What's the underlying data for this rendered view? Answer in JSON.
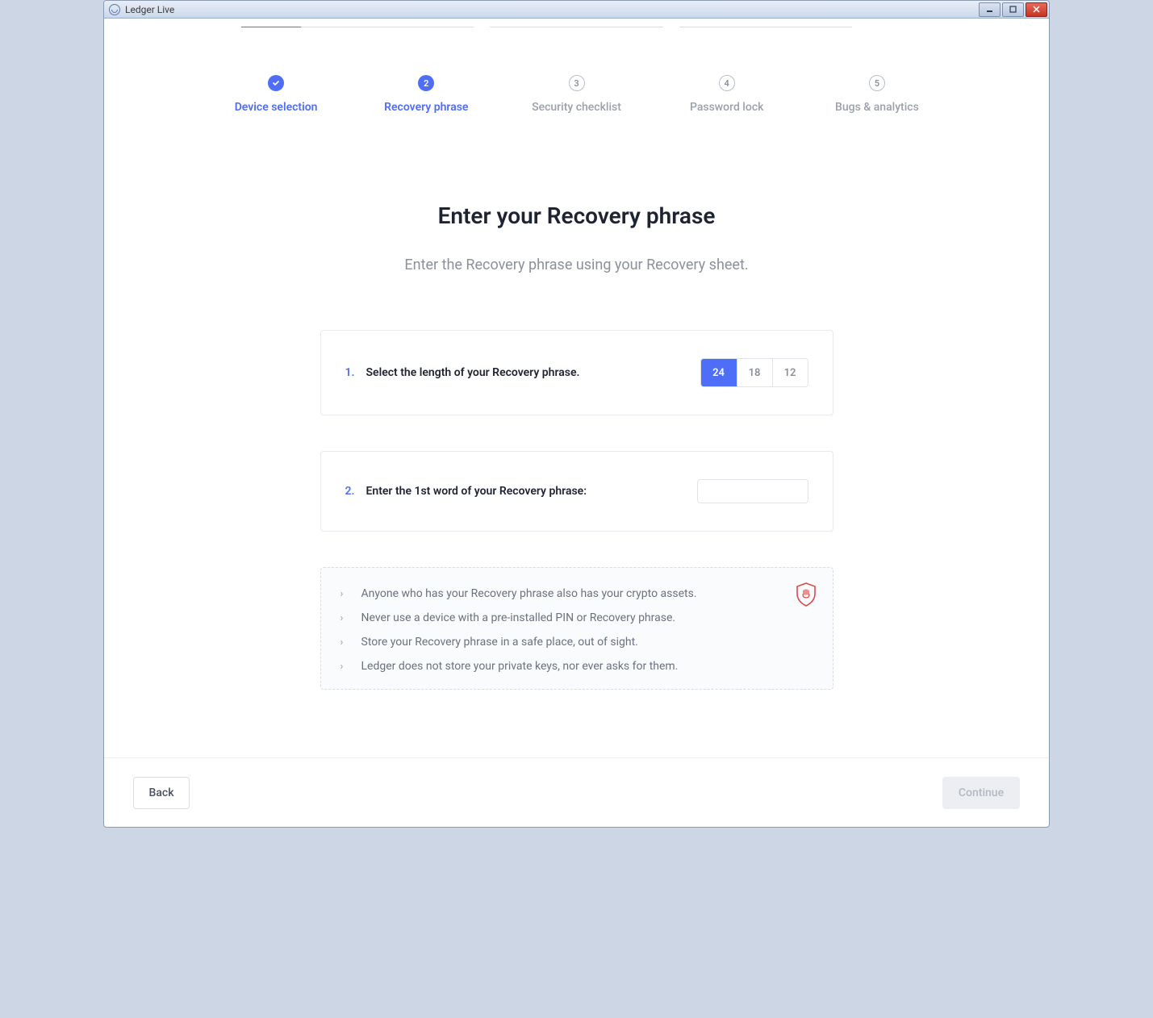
{
  "window": {
    "title": "Ledger Live"
  },
  "steps": [
    {
      "label": "Device selection",
      "state": "done",
      "indicator": "✓"
    },
    {
      "label": "Recovery phrase",
      "state": "active",
      "indicator": "2"
    },
    {
      "label": "Security checklist",
      "state": "pending",
      "indicator": "3"
    },
    {
      "label": "Password lock",
      "state": "pending",
      "indicator": "4"
    },
    {
      "label": "Bugs & analytics",
      "state": "pending",
      "indicator": "5"
    }
  ],
  "heading": "Enter your Recovery phrase",
  "subtitle": "Enter the Recovery phrase using your Recovery sheet.",
  "step1": {
    "num": "1.",
    "text": "Select the length of your Recovery phrase.",
    "options": [
      "24",
      "18",
      "12"
    ],
    "selected": "24"
  },
  "step2": {
    "num": "2.",
    "text": "Enter the 1st word of your Recovery phrase:",
    "value": ""
  },
  "warnings": [
    "Anyone who has your Recovery phrase also has your crypto assets.",
    "Never use a device with a pre-installed PIN or Recovery phrase.",
    "Store your Recovery phrase in a safe place, out of sight.",
    "Ledger does not store your private keys, nor ever asks for them."
  ],
  "footer": {
    "back": "Back",
    "continue": "Continue"
  }
}
